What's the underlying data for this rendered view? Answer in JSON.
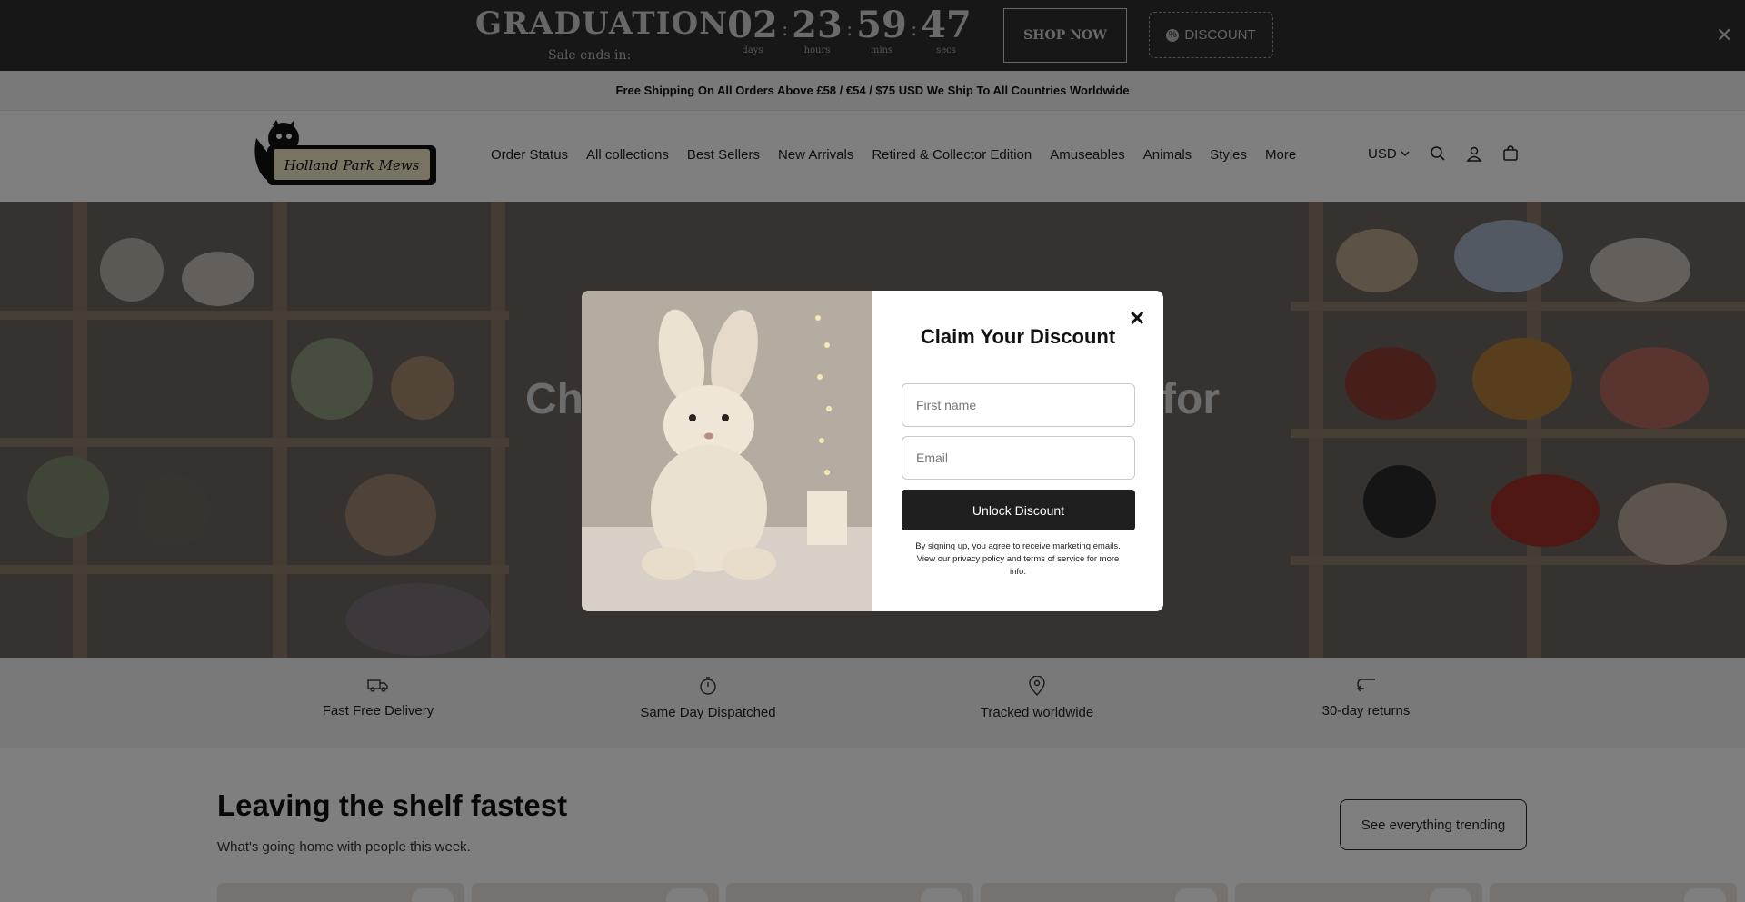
{
  "countdown": {
    "title": "GRADUATION",
    "subtitle": "Sale ends in:",
    "units": [
      {
        "value": "02",
        "label": "days"
      },
      {
        "value": "23",
        "label": "hours"
      },
      {
        "value": "59",
        "label": "mins"
      },
      {
        "value": "47",
        "label": "secs"
      }
    ],
    "shop_now": "SHOP NOW",
    "discount": "DISCOUNT",
    "close": "✕"
  },
  "announcement": "Free Shipping On All Orders Above £58 / €54 / $75 USD We Ship To All Countries Worldwide",
  "header": {
    "logo_text": "Holland Park Mews",
    "nav": [
      "Order Status",
      "All collections",
      "Best Sellers",
      "New Arrivals",
      "Retired & Collector Edition",
      "Amuseables",
      "Animals",
      "Styles",
      "More"
    ],
    "currency": "USD"
  },
  "hero": {
    "headline_left": "Ch",
    "headline_right": "for"
  },
  "features": [
    {
      "label": "Fast Free Delivery",
      "icon": "truck-icon"
    },
    {
      "label": "Same Day Dispatched",
      "icon": "stopwatch-icon"
    },
    {
      "label": "Tracked worldwide",
      "icon": "map-pin-icon"
    },
    {
      "label": "30-day returns",
      "icon": "return-arrow-icon"
    }
  ],
  "section": {
    "title": "Leaving the shelf fastest",
    "subtitle": "What's going home with people this week.",
    "cta": "See everything trending"
  },
  "modal": {
    "title": "Claim Your Discount",
    "first_name_placeholder": "First name",
    "email_placeholder": "Email",
    "submit": "Unlock Discount",
    "terms": "By signing up, you agree to receive marketing emails. View our privacy policy and terms of service for more info.",
    "close": "✕"
  }
}
